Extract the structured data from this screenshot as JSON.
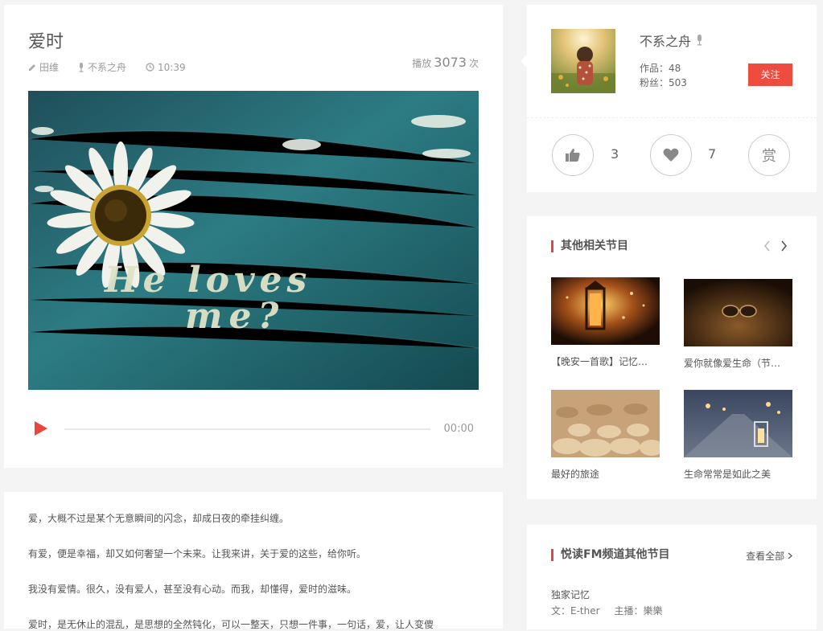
{
  "episode": {
    "title": "爱时",
    "author": "田维",
    "anchor": "不系之舟",
    "duration": "10:39",
    "plays_prefix": "播放",
    "plays": "3073",
    "plays_suffix": "次",
    "cover_text_line1": "He loves",
    "cover_text_line2": "me?",
    "player": {
      "current_time": "00:00",
      "progress": 0
    }
  },
  "description": {
    "paragraphs": [
      "爱，大概不过是某个无意瞬间的闪念，却成日夜的牵挂纠缠。",
      "有爱，便是幸福，却又如何奢望一个未来。让我来讲，关于爱的这些，给你听。",
      "我没有爱情。很久，没有爱人，甚至没有心动。而我，却懂得，爱时的滋味。",
      "爱时，是无休止的混乱，是思想的全然钝化，可以一整天，只想一件事，一句话，爱，让人变傻"
    ]
  },
  "author_card": {
    "name": "不系之舟",
    "works_label": "作品：",
    "works": "48",
    "fans_label": "粉丝：",
    "fans": "503",
    "follow_label": "关注",
    "likes": "3",
    "favorites": "7",
    "reward_label": "赏"
  },
  "related": {
    "title": "其他相关节目",
    "items": [
      {
        "caption": "【晚安一首歌】记忆…",
        "icon": "lantern-photo"
      },
      {
        "caption": "爱你就像爱生命（节…",
        "icon": "glasses-photo"
      },
      {
        "caption": "最好的旅途",
        "icon": "pebbles-photo"
      },
      {
        "caption": "生命常常是如此之美",
        "icon": "street-lantern-photo"
      }
    ]
  },
  "channel": {
    "title": "悦读FM频道其他节目",
    "see_all": "查看全部",
    "item_title": "独家记忆",
    "item_author": "文：E-ther",
    "item_host": "主播：樂樂"
  },
  "colors": {
    "accent": "#e8453c",
    "follow_button": "#ef4c40",
    "background": "#f4f4f4"
  }
}
